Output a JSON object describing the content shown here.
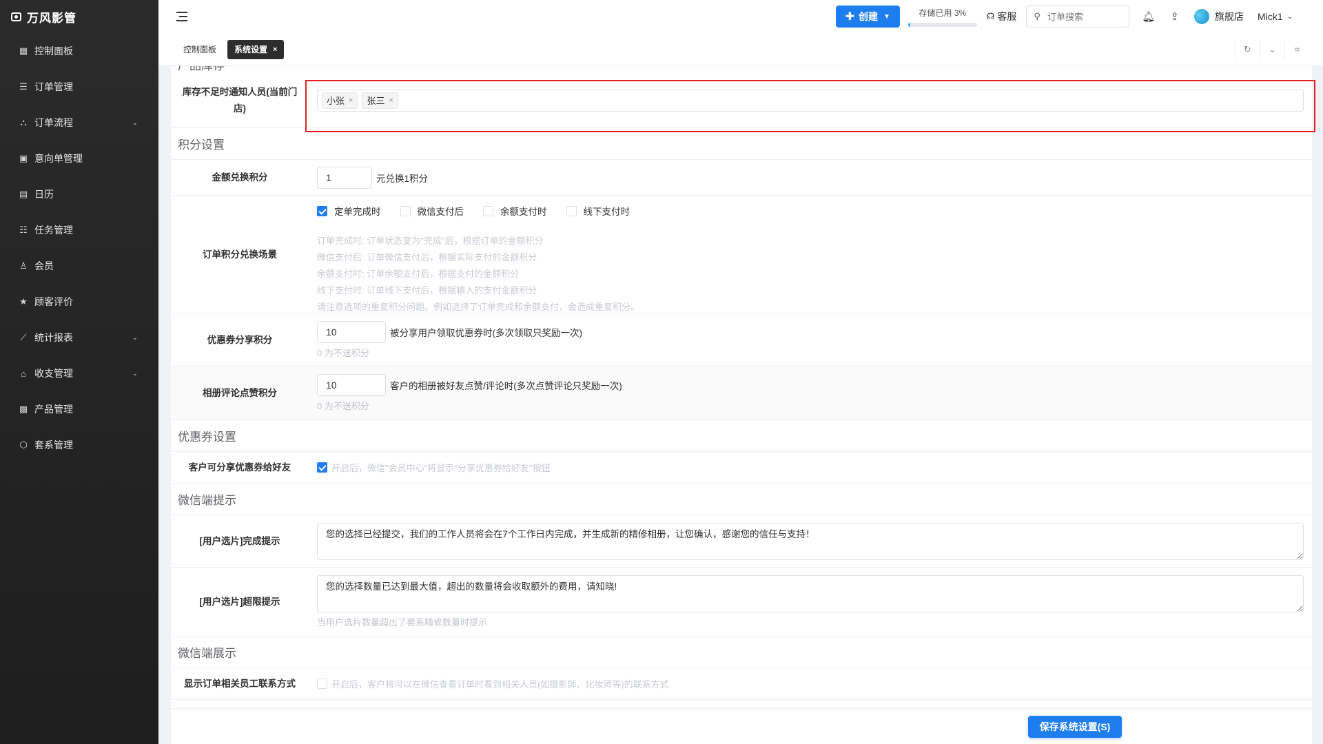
{
  "app": {
    "name": "万风影管"
  },
  "sidebar": {
    "items": [
      {
        "label": "控制面板",
        "icon": "grid-icon"
      },
      {
        "label": "订单管理",
        "icon": "list-icon"
      },
      {
        "label": "订单流程",
        "icon": "flow-icon",
        "has_children": true
      },
      {
        "label": "意向单管理",
        "icon": "doc-icon"
      },
      {
        "label": "日历",
        "icon": "calendar-icon"
      },
      {
        "label": "任务管理",
        "icon": "task-icon"
      },
      {
        "label": "会员",
        "icon": "user-icon"
      },
      {
        "label": "顾客评价",
        "icon": "star-icon"
      },
      {
        "label": "统计报表",
        "icon": "chart-icon",
        "has_children": true
      },
      {
        "label": "收支管理",
        "icon": "bank-icon",
        "has_children": true
      },
      {
        "label": "产品管理",
        "icon": "product-icon"
      },
      {
        "label": "套系管理",
        "icon": "package-icon"
      }
    ]
  },
  "topbar": {
    "create_label": "创建",
    "storage_label": "存储已用 3%",
    "storage_fraction": 0.03,
    "service_label": "客服",
    "search_placeholder": "订单搜索",
    "store_label": "旗舰店",
    "user_label": "Mick1"
  },
  "tabs": [
    {
      "label": "控制面板",
      "active": false
    },
    {
      "label": "系统设置",
      "active": true
    }
  ],
  "settings": {
    "partial_title": "产品库存",
    "stock_notify": {
      "label": "库存不足时通知人员(当前门店)",
      "tags": [
        "小张",
        "张三"
      ]
    },
    "points_title": "积分设置",
    "amount_exchange": {
      "label": "金额兑换积分",
      "value": "1",
      "suffix": "元兑换1积分"
    },
    "order_scene": {
      "label": "订单积分兑换场景",
      "options": [
        {
          "label": "定单完成时",
          "checked": true
        },
        {
          "label": "微信支付后",
          "checked": false
        },
        {
          "label": "余额支付时",
          "checked": false
        },
        {
          "label": "线下支付时",
          "checked": false
        }
      ],
      "hints": [
        "订单完成时: 订单状态变为\"完成\"后，根据订单的金额积分",
        "微信支付后: 订单微信支付后，根据实际支付的金额积分",
        "余额支付时: 订单余额支付后，根据支付的金额积分",
        "线下支付时: 订单线下支付后，根据输入的支付金额积分",
        "请注意选项的重复积分问题。例如选择了订单完成和余额支付，会造成重复积分。"
      ]
    },
    "coupon_share_points": {
      "label": "优惠券分享积分",
      "value": "10",
      "suffix": "被分享用户领取优惠券时(多次领取只奖励一次)",
      "hint": "0 为不送积分"
    },
    "album_points": {
      "label": "相册评论点赞积分",
      "value": "10",
      "suffix": "客户的相册被好友点赞/评论时(多次点赞评论只奖励一次)",
      "hint": "0 为不送积分"
    },
    "coupon_title": "优惠券设置",
    "coupon_share": {
      "label": "客户可分享优惠券给好友",
      "checked": true,
      "hint": "开启后，微信\"会员中心\"将显示\"分享优惠券给好友\"按钮"
    },
    "wechat_tips_title": "微信端提示",
    "select_done": {
      "label": "[用户选片]完成提示",
      "value": "您的选择已经提交，我们的工作人员将会在7个工作日内完成，并生成新的精修相册，让您确认，感谢您的信任与支持！"
    },
    "select_limit": {
      "label": "[用户选片]超限提示",
      "value": "您的选择数量已达到最大值，超出的数量将会收取额外的费用，请知晓!",
      "hint": "当用户选片数量超出了套系精修数量时提示"
    },
    "wechat_display_title": "微信端展示",
    "staff_contact": {
      "label": "显示订单相关员工联系方式",
      "checked": false,
      "hint": "开启后，客户将可以在微信查看订单时看到相关人员(如摄影師、化妆师等)的联系方式"
    }
  },
  "footer": {
    "save_label": "保存系统设置(S)"
  },
  "colors": {
    "accent": "#1e7ef0",
    "highlight": "#e02020",
    "sidebar_bg": "#262626"
  }
}
